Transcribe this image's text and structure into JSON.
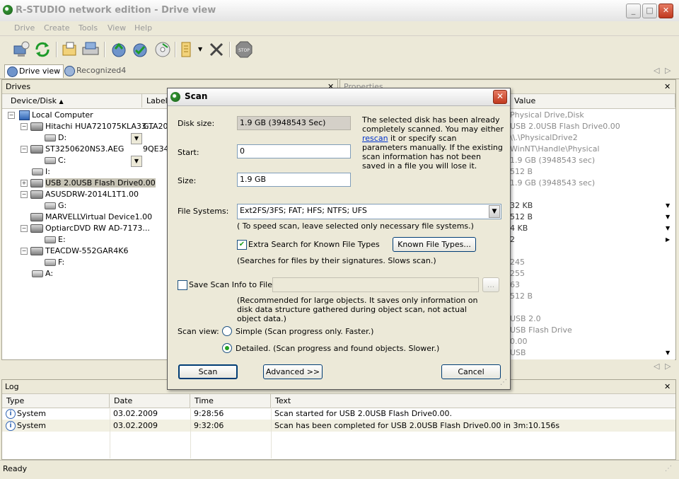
{
  "window": {
    "title": "R-STUDIO network edition - Drive view"
  },
  "menu": {
    "items": [
      "Drive",
      "Create",
      "Tools",
      "View",
      "Help"
    ]
  },
  "toolbar": {
    "icons": [
      "connect-icon",
      "refresh-icon",
      "open-images-icon",
      "scan-icon",
      "recover-icon",
      "recover-marked-icon",
      "create-image-icon",
      "region-icon",
      "remove-icon",
      "stop-icon"
    ]
  },
  "tabs": {
    "drive_view": "Drive view",
    "recognized": "Recognized4"
  },
  "drives": {
    "title": "Drives",
    "col_device": "Device/Disk",
    "col_label": "Label",
    "rows": [
      {
        "text": "Local Computer",
        "label": ""
      },
      {
        "text": "Hitachi HUA721075KLA33...",
        "label": "GTA20"
      },
      {
        "text": "D:",
        "label": ""
      },
      {
        "text": "ST3250620NS3.AEG",
        "label": "9QE34"
      },
      {
        "text": "C:",
        "label": ""
      },
      {
        "text": "I:",
        "label": ""
      },
      {
        "text": "USB 2.0USB Flash Drive0.00",
        "label": ""
      },
      {
        "text": "ASUSDRW-2014L1T1.00",
        "label": ""
      },
      {
        "text": "G:",
        "label": ""
      },
      {
        "text": "MARVELLVirtual Device1.00",
        "label": ""
      },
      {
        "text": "OptiarcDVD RW AD-7173...",
        "label": ""
      },
      {
        "text": "E:",
        "label": ""
      },
      {
        "text": "TEACDW-552GAR4K6",
        "label": ""
      },
      {
        "text": "F:",
        "label": ""
      },
      {
        "text": "A:",
        "label": ""
      }
    ]
  },
  "properties": {
    "title": "Properties",
    "col_value": "Value",
    "values": [
      "Physical Drive,Disk",
      "USB 2.0USB Flash Drive0.00",
      "\\\\.\\PhysicalDrive2",
      "WinNT\\Handle\\Physical",
      "1.9 GB (3948543 sec)",
      "512 B",
      "1.9 GB (3948543 sec)",
      "",
      "32 KB",
      "512 B",
      "4 KB",
      "2",
      "",
      "245",
      "255",
      "63",
      "512 B",
      "",
      "USB 2.0",
      "USB Flash Drive",
      "0.00",
      "USB"
    ]
  },
  "log": {
    "title": "Log",
    "headers": [
      "Type",
      "Date",
      "Time",
      "Text"
    ],
    "rows": [
      {
        "type": "System",
        "date": "03.02.2009",
        "time": "9:28:56",
        "text": "Scan started for USB 2.0USB Flash Drive0.00."
      },
      {
        "type": "System",
        "date": "03.02.2009",
        "time": "9:32:06",
        "text": "Scan has been completed for USB 2.0USB Flash Drive0.00 in 3m:10.156s"
      }
    ]
  },
  "status": {
    "text": "Ready"
  },
  "dialog": {
    "title": "Scan",
    "disk_size_label": "Disk size:",
    "disk_size_value": "1.9 GB (3948543 Sec)",
    "start_label": "Start:",
    "start_value": "0",
    "size_label": "Size:",
    "size_value": "1.9 GB",
    "note_part1": "The selected disk has been already completely scanned. You may either",
    "note_link": "rescan",
    "note_part2": "it or specify scan parameters manually. If the existing scan information has not been saved in a file you will lose it.",
    "fs_label": "File Systems:",
    "fs_value": "Ext2FS/3FS; FAT; HFS; NTFS; UFS",
    "fs_hint": "( To speed scan, leave selected only necessary file systems.)",
    "extra_search_label": "Extra Search for Known File Types",
    "known_types_button": "Known File Types...",
    "extra_search_hint": "(Searches for files by their signatures. Slows scan.)",
    "save_scan_label": "Save Scan Info to File:",
    "browse_button": "...",
    "save_scan_hint": "(Recommended for large objects. It saves only information on disk data structure gathered during object scan, not actual object data.)",
    "scan_view_label": "Scan view:",
    "simple_option": "Simple (Scan progress only. Faster.)",
    "detailed_option": "Detailed. (Scan progress and found objects. Slower.)",
    "scan_button": "Scan",
    "advanced_button": "Advanced >>",
    "cancel_button": "Cancel",
    "extra_search_checked": true,
    "save_scan_checked": false,
    "selected_view": "Detailed"
  }
}
